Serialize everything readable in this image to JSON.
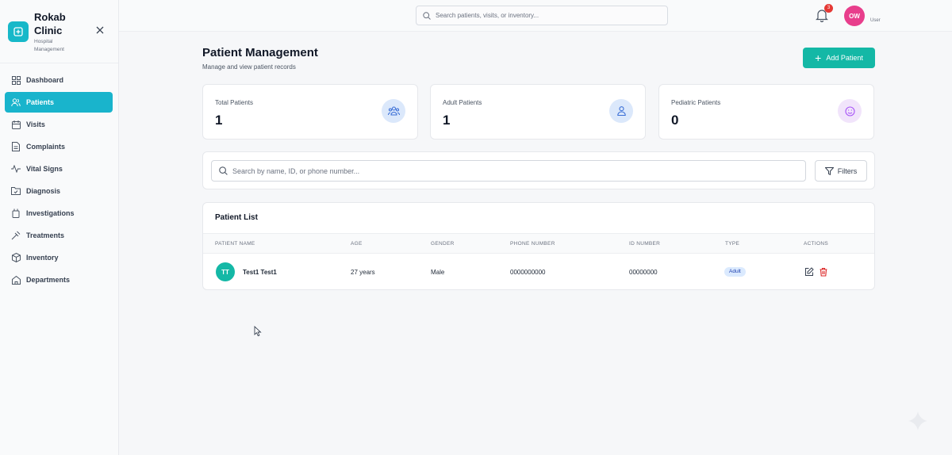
{
  "brand": {
    "title": "Rokab Clinic",
    "subtitle": "Hospital Management"
  },
  "sidebar": {
    "items": [
      {
        "label": "Dashboard",
        "icon": "dashboard-icon",
        "active": false
      },
      {
        "label": "Patients",
        "icon": "users-icon",
        "active": true
      },
      {
        "label": "Visits",
        "icon": "calendar-icon",
        "active": false
      },
      {
        "label": "Complaints",
        "icon": "document-icon",
        "active": false
      },
      {
        "label": "Vital Signs",
        "icon": "pulse-icon",
        "active": false
      },
      {
        "label": "Diagnosis",
        "icon": "folder-icon",
        "active": false
      },
      {
        "label": "Investigations",
        "icon": "flask-icon",
        "active": false
      },
      {
        "label": "Treatments",
        "icon": "pill-icon",
        "active": false
      },
      {
        "label": "Inventory",
        "icon": "box-icon",
        "active": false
      },
      {
        "label": "Departments",
        "icon": "building-icon",
        "active": false
      }
    ]
  },
  "topbar": {
    "search_placeholder": "Search patients, visits, or inventory...",
    "notification_count": "3",
    "avatar_initials": "OW",
    "user_label": "User"
  },
  "page": {
    "title": "Patient Management",
    "subtitle": "Manage and view patient records",
    "add_button": "Add Patient"
  },
  "stats": [
    {
      "label": "Total Patients",
      "value": "1",
      "icon": "group-icon",
      "color": "#dbe8fb"
    },
    {
      "label": "Adult Patients",
      "value": "1",
      "icon": "user-icon",
      "color": "#dbe8fb"
    },
    {
      "label": "Pediatric Patients",
      "value": "0",
      "icon": "smile-icon",
      "color": "#f1e4fb"
    }
  ],
  "filters": {
    "search_placeholder": "Search by name, ID, or phone number...",
    "filters_label": "Filters"
  },
  "patient_list": {
    "title": "Patient List",
    "columns": [
      "PATIENT NAME",
      "AGE",
      "GENDER",
      "PHONE NUMBER",
      "ID NUMBER",
      "TYPE",
      "ACTIONS"
    ],
    "rows": [
      {
        "initials": "TT",
        "name": "Test1 Test1",
        "age": "27 years",
        "gender": "Male",
        "phone": "0000000000",
        "id_number": "00000000",
        "type": "Adult"
      }
    ]
  },
  "colors": {
    "accent": "#19b4cc",
    "primary_button": "#14b8a6",
    "badge": "#e53935",
    "avatar": "#e83e8c"
  }
}
